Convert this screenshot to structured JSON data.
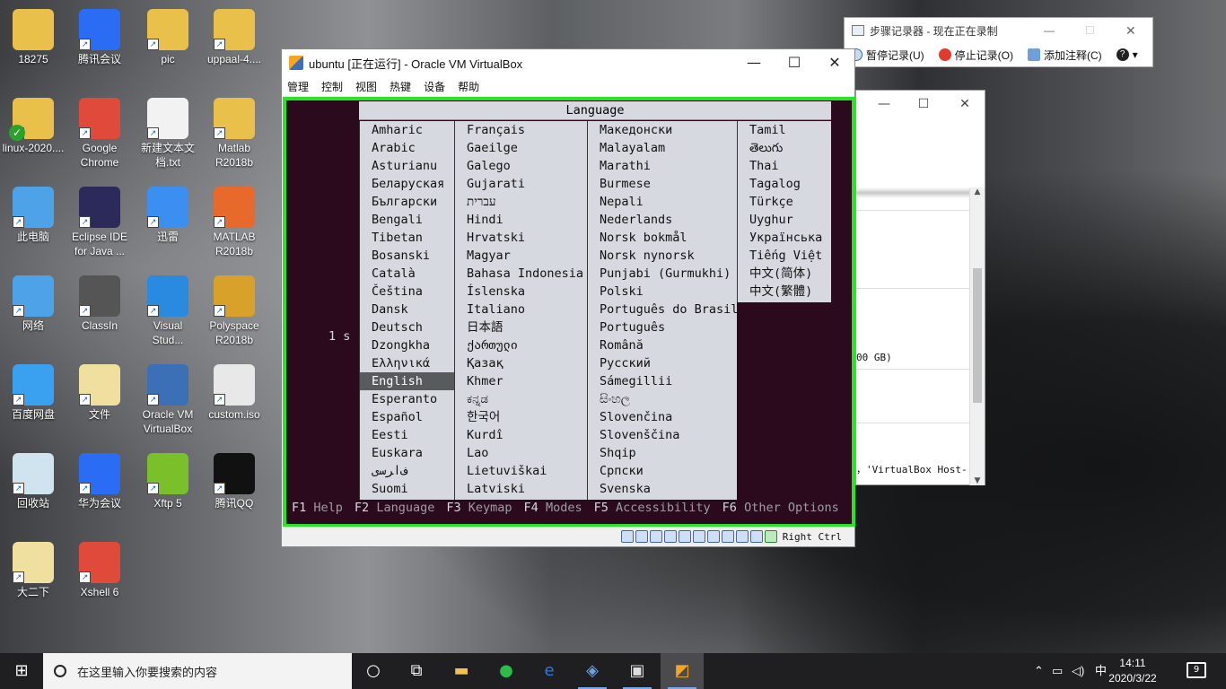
{
  "desktop": {
    "icons": [
      {
        "label": "18275",
        "color": "#e8c04a"
      },
      {
        "label": "腾讯会议",
        "color": "#2a6df4"
      },
      {
        "label": "pic",
        "color": "#e8c04a"
      },
      {
        "label": "uppaal-4....",
        "color": "#e8c04a"
      },
      {
        "label": "linux-2020....",
        "color": "#e8c04a"
      },
      {
        "label": "Google\nChrome",
        "color": "#e04a3a"
      },
      {
        "label": "新建文本文\n档.txt",
        "color": "#f2f2f2"
      },
      {
        "label": "Matlab\nR2018b",
        "color": "#e8c04a"
      },
      {
        "label": "此电脑",
        "color": "#4ea3e8"
      },
      {
        "label": "Eclipse IDE\nfor Java ...",
        "color": "#2c2a5a"
      },
      {
        "label": "迅雷",
        "color": "#3b8ff0"
      },
      {
        "label": "MATLAB\nR2018b",
        "color": "#e86a2a"
      },
      {
        "label": "网络",
        "color": "#4ea3e8"
      },
      {
        "label": "ClassIn",
        "color": "#555555"
      },
      {
        "label": "Visual\nStud...",
        "color": "#2a8ae0"
      },
      {
        "label": "Polyspace\nR2018b",
        "color": "#d8a12a"
      },
      {
        "label": "百度网盘",
        "color": "#3aa0f0"
      },
      {
        "label": "文件",
        "color": "#f0e0a0"
      },
      {
        "label": "Oracle VM\nVirtualBox",
        "color": "#3b6fb6"
      },
      {
        "label": "custom.iso",
        "color": "#e8e8e8"
      },
      {
        "label": "回收站",
        "color": "#d0e4f0"
      },
      {
        "label": "华为会议",
        "color": "#2a6df4"
      },
      {
        "label": "Xftp 5",
        "color": "#7ac02a"
      },
      {
        "label": "腾讯QQ",
        "color": "#111111"
      },
      {
        "label": "大二下",
        "color": "#f0e0a0"
      },
      {
        "label": "Xshell 6",
        "color": "#e04a3a"
      }
    ]
  },
  "vbox": {
    "title": "ubuntu [正在运行] - Oracle VM VirtualBox",
    "menu": [
      "管理",
      "控制",
      "视图",
      "热键",
      "设备",
      "帮助"
    ],
    "host_key": "Right Ctrl"
  },
  "boot": {
    "header": "Language",
    "timer": "1 s",
    "selected": "English",
    "columns": [
      [
        "Amharic",
        "Arabic",
        "Asturianu",
        "Беларуская",
        "Български",
        "Bengali",
        "Tibetan",
        "Bosanski",
        "Català",
        "Čeština",
        "Dansk",
        "Deutsch",
        "Dzongkha",
        "Ελληνικά",
        "English",
        "Esperanto",
        "Español",
        "Eesti",
        "Euskara",
        "ﻑﺍﺮﺳی",
        "Suomi"
      ],
      [
        "Français",
        "Gaeilge",
        "Galego",
        "Gujarati",
        "עברית",
        "Hindi",
        "Hrvatski",
        "Magyar",
        "Bahasa Indonesia",
        "Íslenska",
        "Italiano",
        "日本語",
        "ქართული",
        "Қазақ",
        "Khmer",
        "ಕನ್ನಡ",
        "한국어",
        "Kurdî",
        "Lao",
        "Lietuviškai",
        "Latviski"
      ],
      [
        "Македонски",
        "Malayalam",
        "Marathi",
        "Burmese",
        "Nepali",
        "Nederlands",
        "Norsk bokmål",
        "Norsk nynorsk",
        "Punjabi (Gurmukhi)",
        "Polski",
        "Português do Brasil",
        "Português",
        "Română",
        "Русский",
        "Sámegillii",
        "සිංහල",
        "Slovenčina",
        "Slovenščina",
        "Shqip",
        "Српски",
        "Svenska"
      ],
      [
        "Tamil",
        "తెలుగు",
        "Thai",
        "Tagalog",
        "Türkçe",
        "Uyghur",
        "Українська",
        "Tiếng Việt",
        "中文(简体)",
        "中文(繁體)"
      ]
    ],
    "fkeys": [
      {
        "key": "F1",
        "label": "Help"
      },
      {
        "key": "F2",
        "label": "Language"
      },
      {
        "key": "F3",
        "label": "Keymap"
      },
      {
        "key": "F4",
        "label": "Modes"
      },
      {
        "key": "F5",
        "label": "Accessibility"
      },
      {
        "key": "F6",
        "label": "Other Options"
      }
    ]
  },
  "psr": {
    "title": "步骤记录器 - 现在正在录制",
    "pause": "暂停记录(U)",
    "stop": "停止记录(O)",
    "comment": "添加注释(C)"
  },
  "behind": {
    "size_text": "00 GB)",
    "vbox_text": "，'VirtualBox Host-"
  },
  "taskbar": {
    "search_placeholder": "在这里输入你要搜索的内容",
    "ime": "中",
    "time": "14:11",
    "date": "2020/3/22",
    "notifications": "9"
  }
}
